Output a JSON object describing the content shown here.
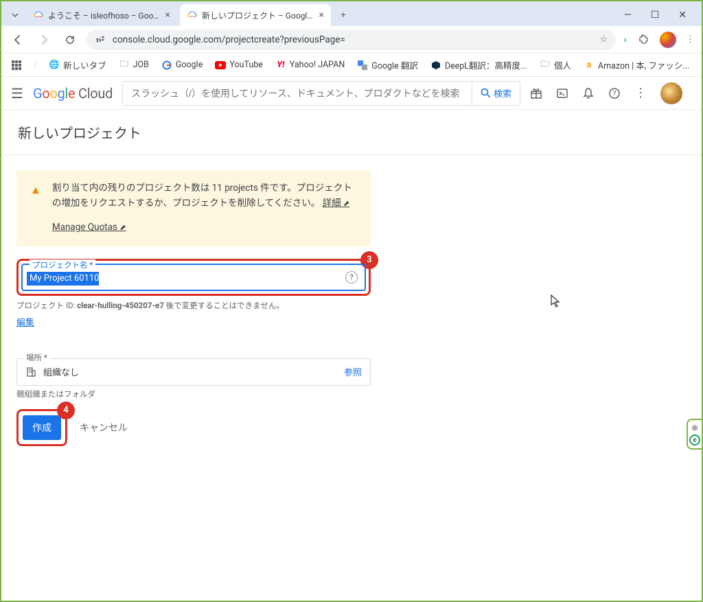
{
  "browser": {
    "tabs": [
      {
        "title": "ようこそ – isleofhoso – Google Cl"
      },
      {
        "title": "新しいプロジェクト – Google Cloud"
      }
    ],
    "url": "console.cloud.google.com/projectcreate?previousPage=",
    "bookmarks": [
      {
        "label": "新しいタブ"
      },
      {
        "label": "JOB"
      },
      {
        "label": "Google"
      },
      {
        "label": "YouTube"
      },
      {
        "label": "Yahoo! JAPAN"
      },
      {
        "label": "Google 翻訳"
      },
      {
        "label": "DeepL翻訳：高精度..."
      },
      {
        "label": "個人"
      },
      {
        "label": "Amazon | 本, ファッシ..."
      }
    ]
  },
  "header": {
    "logo_cloud": "Cloud",
    "search_placeholder": "スラッシュ（/）を使用してリソース、ドキュメント、プロダクトなどを検索",
    "search_button": "検索"
  },
  "page": {
    "title": "新しいプロジェクト",
    "warning": {
      "text_prefix": "割り当て内の残りのプロジェクト数は ",
      "projects": "11 projects",
      "text_suffix": " 件です。プロジェクトの増加をリクエストするか、プロジェクトを削除してください。",
      "details": "詳細",
      "manage_quotas": "Manage Quotas"
    },
    "project_name": {
      "label": "プロジェクト名",
      "value": "My Project 60110",
      "hint_prefix": "プロジェクト ID: ",
      "project_id": "clear-hulling-450207-e7",
      "hint_suffix": " 後で変更することはできません。",
      "edit": "編集"
    },
    "location": {
      "label": "場所",
      "value": "組織なし",
      "browse": "参照",
      "hint": "親組織またはフォルダ"
    },
    "actions": {
      "create": "作成",
      "cancel": "キャンセル"
    },
    "annotations": {
      "badge3": "3",
      "badge4": "4"
    }
  }
}
